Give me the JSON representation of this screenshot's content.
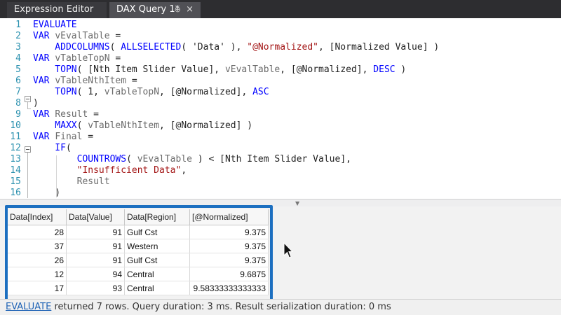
{
  "tabs": [
    {
      "label": "Expression Editor"
    },
    {
      "label": "DAX Query 1*",
      "pin": "⊕",
      "close": "×"
    }
  ],
  "editor": {
    "lines": [
      {
        "num": "1",
        "tokens": [
          {
            "t": "EVALUATE",
            "c": "kw"
          }
        ]
      },
      {
        "num": "2",
        "tokens": [
          {
            "t": "VAR ",
            "c": "kw"
          },
          {
            "t": "vEvalTable",
            "c": "var"
          },
          {
            "t": " =",
            "c": ""
          }
        ]
      },
      {
        "num": "3",
        "tokens": [
          {
            "t": "    ADDCOLUMNS",
            "c": "fn"
          },
          {
            "t": "( ",
            "c": ""
          },
          {
            "t": "ALLSELECTED",
            "c": "fn"
          },
          {
            "t": "( 'Data' ), ",
            "c": ""
          },
          {
            "t": "\"@Normalized\"",
            "c": "str"
          },
          {
            "t": ", [Normalized Value] )",
            "c": ""
          }
        ]
      },
      {
        "num": "4",
        "tokens": [
          {
            "t": "VAR ",
            "c": "kw"
          },
          {
            "t": "vTableTopN",
            "c": "var"
          },
          {
            "t": " =",
            "c": ""
          }
        ]
      },
      {
        "num": "5",
        "tokens": [
          {
            "t": "    TOPN",
            "c": "fn"
          },
          {
            "t": "( [Nth Item Slider Value], ",
            "c": ""
          },
          {
            "t": "vEvalTable",
            "c": "var"
          },
          {
            "t": ", [@Normalized], ",
            "c": ""
          },
          {
            "t": "DESC",
            "c": "kw"
          },
          {
            "t": " )",
            "c": ""
          }
        ]
      },
      {
        "num": "6",
        "tokens": [
          {
            "t": "VAR ",
            "c": "kw"
          },
          {
            "t": "vTableNthItem",
            "c": "var"
          },
          {
            "t": " =",
            "c": ""
          }
        ]
      },
      {
        "num": "7",
        "tokens": [
          {
            "t": "    TOPN",
            "c": "fn"
          },
          {
            "t": "( 1, ",
            "c": ""
          },
          {
            "t": "vTableTopN",
            "c": "var"
          },
          {
            "t": ", [@Normalized], ",
            "c": ""
          },
          {
            "t": "ASC",
            "c": "kw"
          }
        ]
      },
      {
        "num": "8",
        "tokens": [
          {
            "t": ")",
            "c": ""
          }
        ]
      },
      {
        "num": "9",
        "tokens": [
          {
            "t": "VAR ",
            "c": "kw"
          },
          {
            "t": "Result",
            "c": "var"
          },
          {
            "t": " =",
            "c": ""
          }
        ]
      },
      {
        "num": "10",
        "tokens": [
          {
            "t": "    MAXX",
            "c": "fn"
          },
          {
            "t": "( ",
            "c": ""
          },
          {
            "t": "vTableNthItem",
            "c": "var"
          },
          {
            "t": ", [@Normalized] )",
            "c": ""
          }
        ]
      },
      {
        "num": "11",
        "tokens": [
          {
            "t": "VAR ",
            "c": "kw"
          },
          {
            "t": "Final",
            "c": "var"
          },
          {
            "t": " =",
            "c": ""
          }
        ]
      },
      {
        "num": "12",
        "tokens": [
          {
            "t": "    IF",
            "c": "fn"
          },
          {
            "t": "(",
            "c": ""
          }
        ]
      },
      {
        "num": "13",
        "tokens": [
          {
            "t": "        COUNTROWS",
            "c": "fn"
          },
          {
            "t": "( ",
            "c": ""
          },
          {
            "t": "vEvalTable",
            "c": "var"
          },
          {
            "t": " ) < [Nth Item Slider Value],",
            "c": ""
          }
        ]
      },
      {
        "num": "14",
        "tokens": [
          {
            "t": "        \"Insufficient Data\"",
            "c": "str"
          },
          {
            "t": ",",
            "c": ""
          }
        ]
      },
      {
        "num": "15",
        "tokens": [
          {
            "t": "        Result",
            "c": "var"
          }
        ]
      },
      {
        "num": "16",
        "tokens": [
          {
            "t": "    )",
            "c": ""
          }
        ]
      }
    ]
  },
  "results": {
    "columns": [
      "Data[Index]",
      "Data[Value]",
      "Data[Region]",
      "[@Normalized]"
    ],
    "rows": [
      [
        "28",
        "91",
        "Gulf Cst",
        "9.375"
      ],
      [
        "37",
        "91",
        "Western",
        "9.375"
      ],
      [
        "26",
        "91",
        "Gulf Cst",
        "9.375"
      ],
      [
        "12",
        "94",
        "Central",
        "9.6875"
      ],
      [
        "17",
        "93",
        "Central",
        "9.58333333333333"
      ]
    ]
  },
  "status": {
    "link": "EVALUATE",
    "text": " returned 7 rows. Query duration: 3 ms. Result serialization duration: 0 ms"
  },
  "colors": {
    "highlight": "#1c6fc0",
    "keyword": "#0000ff",
    "string": "#a31515",
    "line_number": "#2b91af"
  }
}
